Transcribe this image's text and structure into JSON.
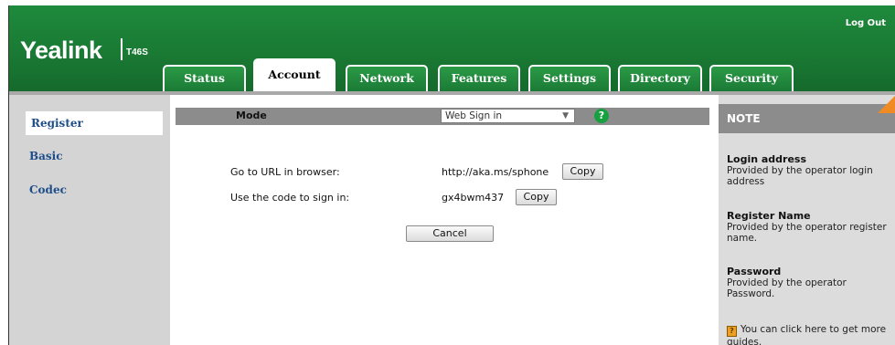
{
  "header": {
    "brand": "Yealink",
    "model": "T46S",
    "logout_label": "Log Out"
  },
  "tabs": [
    {
      "label": "Status",
      "active": false
    },
    {
      "label": "Account",
      "active": true
    },
    {
      "label": "Network",
      "active": false
    },
    {
      "label": "Features",
      "active": false
    },
    {
      "label": "Settings",
      "active": false
    },
    {
      "label": "Directory",
      "active": false
    },
    {
      "label": "Security",
      "active": false
    }
  ],
  "sidebar": {
    "items": [
      {
        "label": "Register",
        "active": true
      },
      {
        "label": "Basic",
        "active": false
      },
      {
        "label": "Codec",
        "active": false
      }
    ]
  },
  "main": {
    "mode_label": "Mode",
    "mode_value": "Web Sign in",
    "help_icon": "question-icon",
    "url_label": "Go to URL in browser:",
    "url_value": "http://aka.ms/sphone",
    "code_label": "Use the code to sign in:",
    "code_value": "gx4bwm437",
    "copy_label": "Copy",
    "cancel_label": "Cancel"
  },
  "note": {
    "heading": "NOTE",
    "items": [
      {
        "title": "Login address",
        "text": "Provided by the operator login address"
      },
      {
        "title": "Register Name",
        "text": "Provided by the operator register name."
      },
      {
        "title": "Password",
        "text": "Provided by the operator Password."
      }
    ],
    "guide_text": "You can click here to get more guides."
  },
  "colors": {
    "header_green": "#1a7a34",
    "link_blue": "#1e4e8a",
    "note_corner": "#f08a24",
    "bar_gray": "#8c8c8c"
  }
}
